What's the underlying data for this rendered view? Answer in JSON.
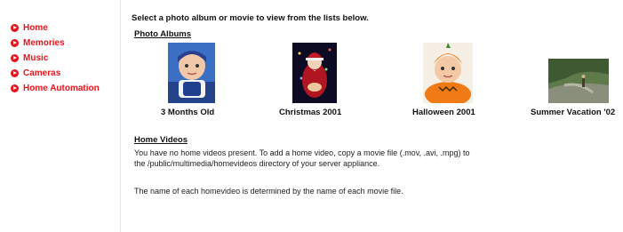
{
  "nav": {
    "items": [
      {
        "label": "Home",
        "icon": "play-circle-icon"
      },
      {
        "label": "Memories",
        "icon": "play-circle-icon"
      },
      {
        "label": "Music",
        "icon": "play-circle-icon"
      },
      {
        "label": "Cameras",
        "icon": "play-circle-icon"
      },
      {
        "label": "Home Automation",
        "icon": "play-circle-icon"
      }
    ]
  },
  "main": {
    "intro": "Select a photo album or movie to view from the lists below.",
    "albums_heading": "Photo Albums",
    "albums": [
      {
        "caption": "3 Months Old"
      },
      {
        "caption": "Christmas 2001"
      },
      {
        "caption": "Halloween 2001"
      },
      {
        "caption": "Summer Vacation '02"
      }
    ],
    "videos_heading": "Home Videos",
    "videos_line1": "You have no home videos present. To add a home video, copy a movie file (.mov, .avi, .mpg) to",
    "videos_line2": "the /public/multimedia/homevideos directory of your server appliance.",
    "videos_note": "The name of each homevideo is determined by the name of each movie file."
  },
  "colors": {
    "accent": "#e8141b",
    "text": "#111111",
    "background": "#ffffff"
  }
}
